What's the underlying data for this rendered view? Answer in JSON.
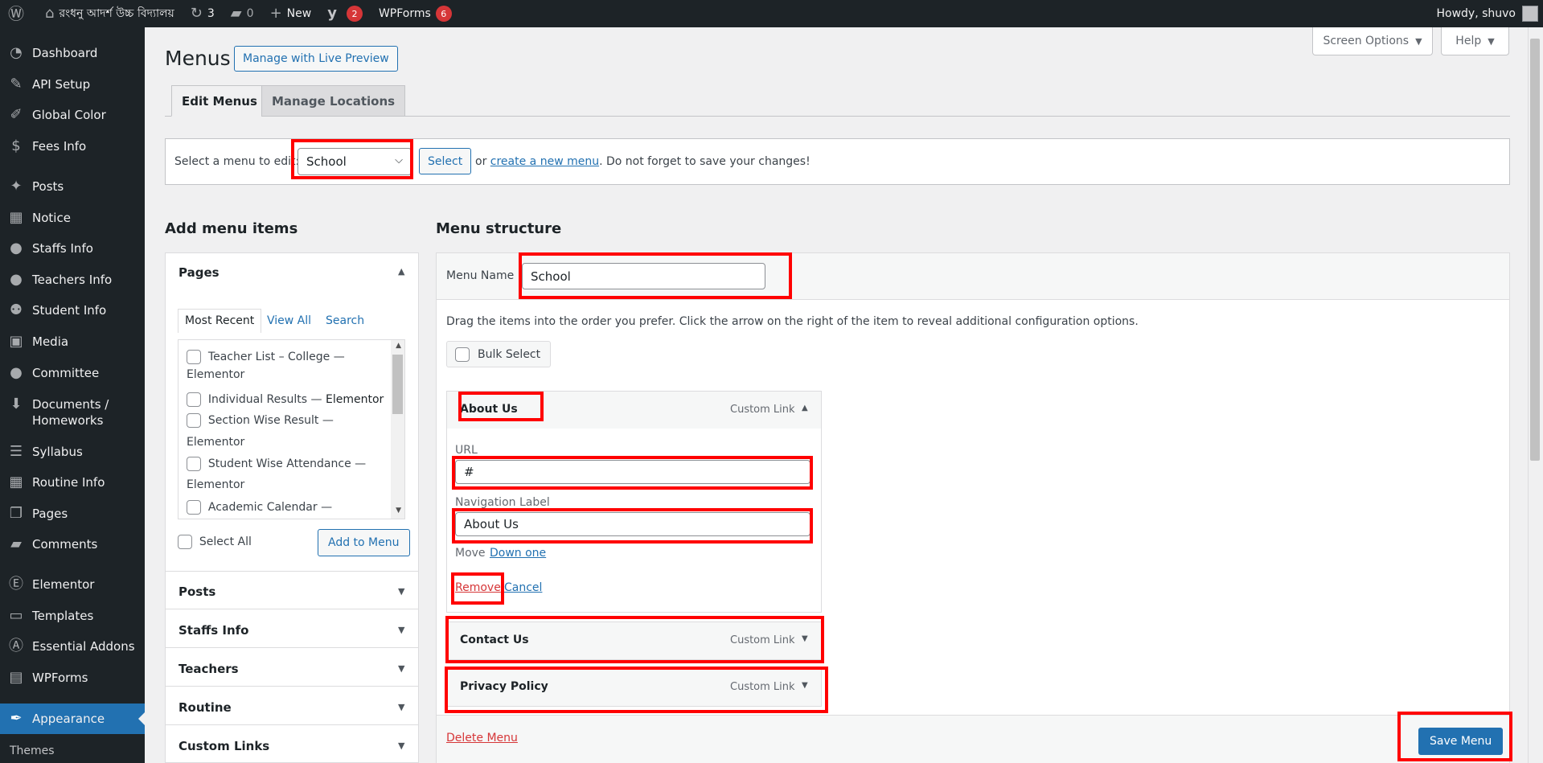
{
  "admin_bar": {
    "wp_logo_icon": "wordpress-icon",
    "site_name": "রংধনু আদর্শ উচ্চ বিদ্যালয়",
    "updates_count": "3",
    "comments_count": "0",
    "new_label": "New",
    "yoast_badge": "2",
    "wpforms_label": "WPForms",
    "wpforms_badge": "6",
    "howdy": "Howdy, shuvo"
  },
  "sidebar": {
    "items": [
      {
        "label": "Dashboard",
        "icon": "dashboard-icon"
      },
      {
        "label": "API Setup",
        "icon": "tools-icon"
      },
      {
        "label": "Global Color",
        "icon": "brush-icon"
      },
      {
        "label": "Fees Info",
        "icon": "dollar-icon"
      },
      {
        "label": "Posts",
        "icon": "pin-icon"
      },
      {
        "label": "Notice",
        "icon": "calendar-icon"
      },
      {
        "label": "Staffs Info",
        "icon": "user-icon"
      },
      {
        "label": "Teachers Info",
        "icon": "user-icon"
      },
      {
        "label": "Student Info",
        "icon": "users-icon"
      },
      {
        "label": "Media",
        "icon": "media-icon"
      },
      {
        "label": "Committee",
        "icon": "user-icon"
      },
      {
        "label": "Documents /",
        "label2": "Homeworks",
        "icon": "download-icon"
      },
      {
        "label": "Syllabus",
        "icon": "list-icon"
      },
      {
        "label": "Routine Info",
        "icon": "calendar-icon"
      },
      {
        "label": "Pages",
        "icon": "pages-icon"
      },
      {
        "label": "Comments",
        "icon": "comment-icon"
      },
      {
        "label": "Elementor",
        "icon": "elementor-icon"
      },
      {
        "label": "Templates",
        "icon": "folder-icon"
      },
      {
        "label": "Essential Addons",
        "icon": "ea-icon"
      },
      {
        "label": "WPForms",
        "icon": "forms-icon"
      },
      {
        "label": "Appearance",
        "icon": "appearance-icon"
      }
    ],
    "submenu": {
      "themes": "Themes"
    }
  },
  "screen_options": "Screen Options",
  "help": "Help",
  "page": {
    "title": "Menus",
    "live_preview": "Manage with Live Preview",
    "tab_edit": "Edit Menus",
    "tab_locations": "Manage Locations"
  },
  "manage": {
    "label": "Select a menu to edit:",
    "selected_menu": "School",
    "select_button": "Select",
    "or_text": "or",
    "create_link": "create a new menu",
    "tail_text": ". Do not forget to save your changes!"
  },
  "add_items": {
    "heading": "Add menu items",
    "pages_title": "Pages",
    "tabs": [
      "Most Recent",
      "View All",
      "Search"
    ],
    "pages": [
      {
        "line1": "Teacher List – College —",
        "line2": "Elementor"
      },
      {
        "line1": "Individual Results — ",
        "bold": "Elementor"
      },
      {
        "line1": "Section Wise Result —",
        "line2": "Elementor"
      },
      {
        "line1": "Student Wise Attendance —",
        "line2": "Elementor"
      },
      {
        "line1": "Academic Calendar —",
        "line2": ""
      }
    ],
    "select_all": "Select All",
    "add_to_menu": "Add to Menu",
    "sections": [
      "Posts",
      "Staffs Info",
      "Teachers",
      "Routine",
      "Custom Links"
    ]
  },
  "structure": {
    "heading": "Menu structure",
    "menu_name_label": "Menu Name",
    "menu_name_value": "School",
    "drag_hint": "Drag the items into the order you prefer. Click the arrow on the right of the item to reveal additional configuration options.",
    "bulk_select": "Bulk Select",
    "items": [
      {
        "title": "About Us",
        "type": "Custom Link"
      },
      {
        "title": "Contact Us",
        "type": "Custom Link"
      },
      {
        "title": "Privacy Policy",
        "type": "Custom Link"
      }
    ],
    "url_label": "URL",
    "url_value": "#",
    "nav_label": "Navigation Label",
    "nav_value": "About Us",
    "move_label": "Move",
    "move_link": "Down one",
    "remove": "Remove",
    "cancel": "Cancel",
    "delete_menu": "Delete Menu",
    "save_menu": "Save Menu"
  },
  "colors": {
    "admin_dark": "#1d2327",
    "wp_blue": "#2271b1",
    "danger": "#d63638",
    "annotation": "#ff0000"
  }
}
